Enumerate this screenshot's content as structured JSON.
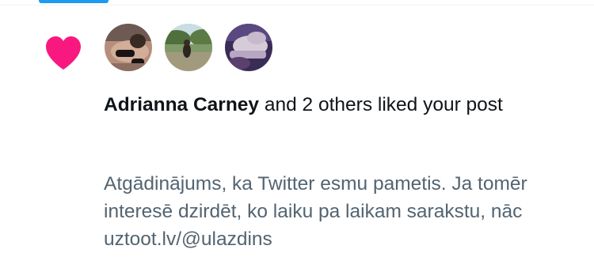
{
  "colors": {
    "accent": "#1d9bf0",
    "like": "#f91880",
    "primary_text": "#0f1419",
    "secondary_text": "#536471"
  },
  "notification": {
    "type_icon": "heart-icon",
    "avatars": [
      {
        "icon": "avatar-photo"
      },
      {
        "icon": "avatar-photo"
      },
      {
        "icon": "avatar-photo"
      }
    ],
    "actor_name": "Adrianna Carney",
    "message_suffix": " and 2 others liked your post",
    "post_text": "Atgādinājums, ka Twitter esmu pametis. Ja tomēr interesē dzirdēt, ko laiku pa laikam sarakstu, nāc uztoot.lv/@ulazdins"
  }
}
